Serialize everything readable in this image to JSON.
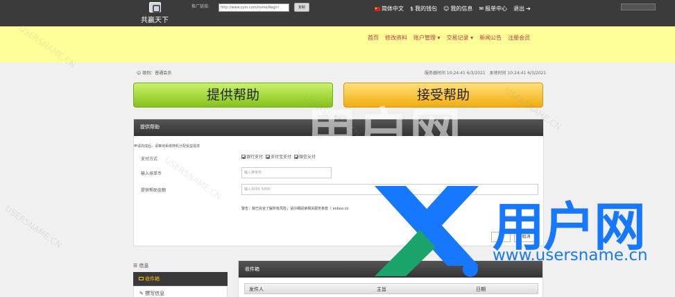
{
  "header": {
    "logo_text": "共赢天下",
    "promo_label": "推广链接:",
    "promo_url": "http://www.cym.com/home/Reg/ri",
    "copy_label": "复制",
    "menu": [
      {
        "label": "简体中文",
        "icon": "flag-icon"
      },
      {
        "label": "我的钱包",
        "icon": "dollar-icon"
      },
      {
        "label": "我的信息",
        "icon": "user-icon"
      },
      {
        "label": "报单中心",
        "icon": "envelope-icon"
      },
      {
        "label": "退出",
        "icon": "arrow-right-icon"
      }
    ]
  },
  "nav": {
    "items": [
      "首页",
      "修改资料",
      "账户管理",
      "交易记录",
      "新闻公告",
      "注册会员"
    ],
    "color": "#cc3333"
  },
  "info": {
    "level": "级别：普通会员",
    "server_time": "服务器时间  10:24:41 6/3/2021",
    "local_time": "本地时间  10:24:41 6/3/2021"
  },
  "actions": {
    "provide_help": "提供帮助",
    "accept_help": "接受帮助"
  },
  "form": {
    "title": "提供帮助",
    "notice": "申请完成后，请等待系统随机分配受益需求",
    "payment_label": "支付方式",
    "payment_options": [
      {
        "label": "银行支付",
        "checked": true
      },
      {
        "label": "支付宝支付",
        "checked": true
      },
      {
        "label": "微信支付",
        "checked": true
      }
    ],
    "coin_label": "输入排单币",
    "coin_placeholder": "输入排单币",
    "amount_label": "提供帮助金额",
    "amount_placeholder": "输入3000 5000",
    "warning": "警告：我已完全了解所有风险，请仔细阅读相关服务条款（ enboo.co",
    "confirm_label": "确",
    "cancel_label": "取消"
  },
  "sidebar": {
    "title": "信息",
    "inbox_label": "收件箱",
    "compose_label": "撰写信息"
  },
  "inbox": {
    "title": "收件箱",
    "columns": [
      "发件人",
      "主旨",
      "日期"
    ]
  },
  "watermark": {
    "brand": "用户网",
    "url": "www.usersname.cn",
    "repeated_text": "USERSNAME.CN",
    "brand_color": "#1677ff"
  }
}
